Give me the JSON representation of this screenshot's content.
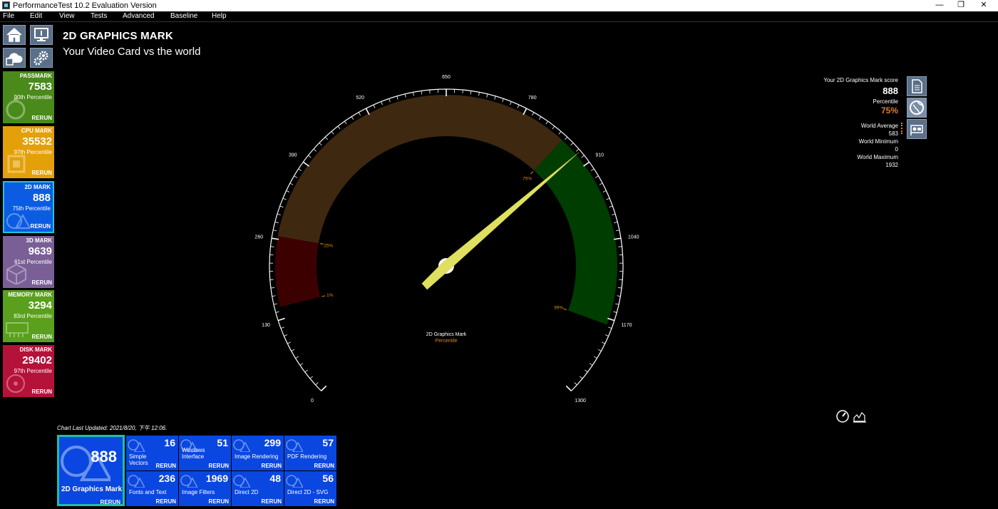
{
  "window": {
    "title": "PerformanceTest 10.2 Evaluation Version"
  },
  "menu": [
    "File",
    "Edit",
    "View",
    "Tests",
    "Advanced",
    "Baseline",
    "Help"
  ],
  "page": {
    "title": "2D GRAPHICS MARK",
    "subtitle": "Your Video Card vs the world"
  },
  "side_tiles": [
    {
      "name": "PASSMARK",
      "value": "7583",
      "percentile": "90th Percentile",
      "rerun": "RERUN",
      "color": "#4a8a1a"
    },
    {
      "name": "CPU MARK",
      "value": "35532",
      "percentile": "97th Percentile",
      "rerun": "RERUN",
      "color": "#e3a008"
    },
    {
      "name": "2D MARK",
      "value": "888",
      "percentile": "75th Percentile",
      "rerun": "RERUN",
      "color": "#0b5ce3"
    },
    {
      "name": "3D MARK",
      "value": "9639",
      "percentile": "61st Percentile",
      "rerun": "RERUN",
      "color": "#7a5f96"
    },
    {
      "name": "MEMORY MARK",
      "value": "3294",
      "percentile": "83rd Percentile",
      "rerun": "RERUN",
      "color": "#5aa01c"
    },
    {
      "name": "DISK MARK",
      "value": "29402",
      "percentile": "97th Percentile",
      "rerun": "RERUN",
      "color": "#b5123a"
    }
  ],
  "score_panel": {
    "score_label": "Your 2D Graphics Mark score",
    "score": "888",
    "percentile_label": "Percentile",
    "percentile": "75%",
    "world_average_label": "World Average",
    "world_average": "583",
    "world_minimum_label": "World Minimum",
    "world_minimum": "0",
    "world_maximum_label": "World Maximum",
    "world_maximum": "1932"
  },
  "gauge": {
    "ticks": [
      "0",
      "130",
      "260",
      "390",
      "520",
      "650",
      "780",
      "910",
      "1040",
      "1170",
      "1300"
    ],
    "percentile_markers": [
      "1%",
      "25%",
      "75%",
      "99%"
    ],
    "caption": "2D Graphics Mark",
    "sub_caption": "Percentile",
    "value": 888,
    "min": 0,
    "max": 1300,
    "colors": {
      "red": "#3d0000",
      "brown": "#3f2810",
      "green": "#003d00",
      "needle": "#e0e060",
      "marker": "#e08a00"
    }
  },
  "chart_updated": "Chart Last Updated: 2021/8/20, 下午 12:06.",
  "big_tile": {
    "value": "888",
    "name": "2D Graphics Mark",
    "rerun": "RERUN"
  },
  "sub_tests": [
    {
      "value": "16",
      "name": "Simple Vectors",
      "rerun": "RERUN"
    },
    {
      "value": "51",
      "name": "Windows Interface",
      "rerun": "RERUN"
    },
    {
      "value": "299",
      "name": "Image Rendering",
      "rerun": "RERUN"
    },
    {
      "value": "57",
      "name": "PDF Rendering",
      "rerun": "RERUN"
    },
    {
      "value": "236",
      "name": "Fonts and Text",
      "rerun": "RERUN"
    },
    {
      "value": "1969",
      "name": "Image Filters",
      "rerun": "RERUN"
    },
    {
      "value": "48",
      "name": "Direct 2D",
      "rerun": "RERUN"
    },
    {
      "value": "56",
      "name": "Direct 2D - SVG",
      "rerun": "RERUN"
    }
  ]
}
